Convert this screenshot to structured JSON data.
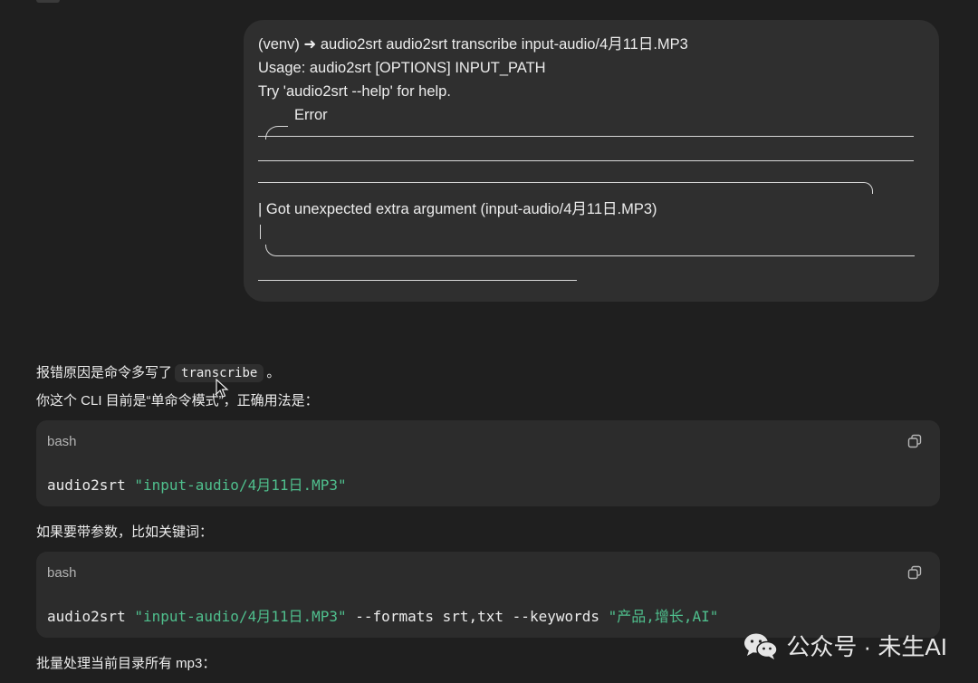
{
  "user_message": {
    "lines": [
      "(venv) ➜  audio2srt audio2srt transcribe input-audio/4月11日.MP3",
      "Usage: audio2srt [OPTIONS] INPUT_PATH",
      "Try 'audio2srt --help' for help.",
      "Error",
      "| Got unexpected extra argument (input-audio/4月11日.MP3)"
    ]
  },
  "response": {
    "p1_before": "报错原因是命令多写了",
    "p1_code": "transcribe",
    "p1_after": "。",
    "p2": "你这个 CLI 目前是“单命令模式”，正确用法是：",
    "code1": {
      "lang": "bash",
      "cmd": "audio2srt",
      "arg": "\"input-audio/4月11日.MP3\""
    },
    "p3": "如果要带参数，比如关键词：",
    "code2": {
      "lang": "bash",
      "cmd": "audio2srt",
      "arg": "\"input-audio/4月11日.MP3\"",
      "opts": "--formats srt,txt --keywords",
      "kw": "\"产品,增长,AI\""
    },
    "p4": "批量处理当前目录所有 mp3："
  },
  "watermark": {
    "text": "公众号 · 未生AI",
    "icon": "wechat-icon"
  },
  "colors": {
    "background": "#1f1f1f",
    "bubble": "#2f2f2f",
    "code_bg": "#2c2c2c",
    "string": "#4fbf8d"
  }
}
